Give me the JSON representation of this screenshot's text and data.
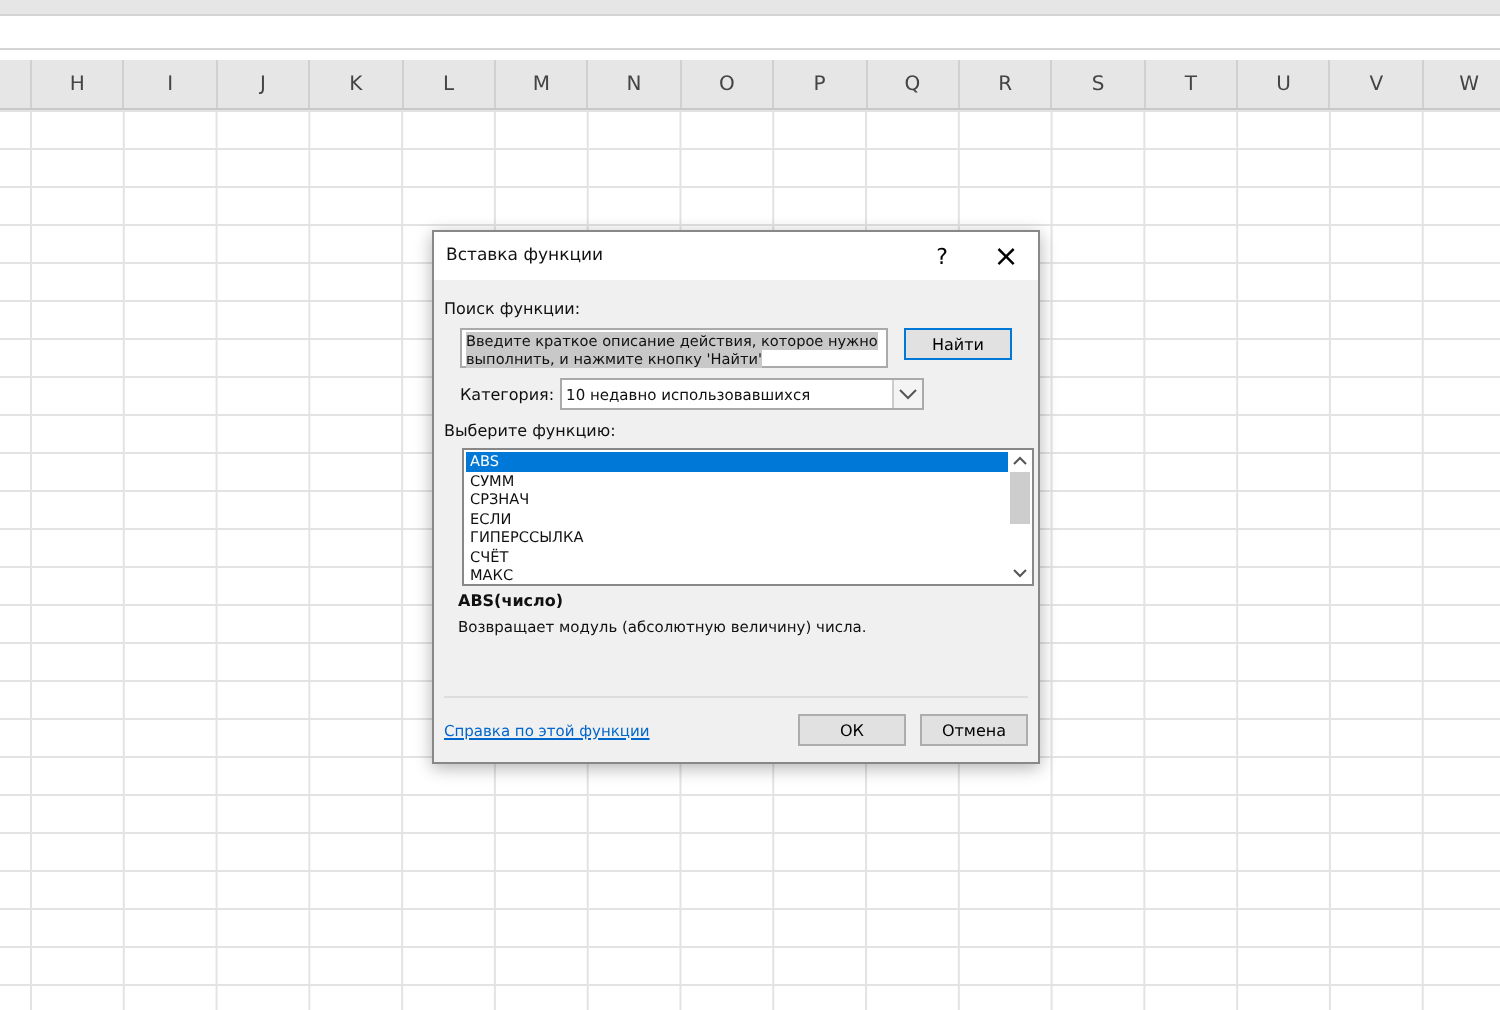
{
  "columns": [
    "H",
    "I",
    "J",
    "K",
    "L",
    "M",
    "N",
    "O",
    "P",
    "Q",
    "R",
    "S",
    "T",
    "U",
    "V",
    "W"
  ],
  "dialog": {
    "title": "Вставка функции",
    "help": "?",
    "close": "×",
    "search_label": "Поиск функции:",
    "search_value": "Введите краткое описание действия, которое нужно выполнить, и нажмите кнопку 'Найти'",
    "find_button": "Найти",
    "category_label": "Категория:",
    "category_value": "10 недавно использовавшихся",
    "list_label": "Выберите функцию:",
    "functions": [
      {
        "name": "ABS",
        "selected": true
      },
      {
        "name": "СУММ",
        "selected": false
      },
      {
        "name": "СРЗНАЧ",
        "selected": false
      },
      {
        "name": "ЕСЛИ",
        "selected": false
      },
      {
        "name": "ГИПЕРССЫЛКА",
        "selected": false
      },
      {
        "name": "СЧЁТ",
        "selected": false
      },
      {
        "name": "МАКС",
        "selected": false
      }
    ],
    "signature": "ABS(число)",
    "description": "Возвращает модуль (абсолютную величину) числа.",
    "help_link": "Справка по этой функции",
    "ok": "ОК",
    "cancel": "Отмена"
  }
}
